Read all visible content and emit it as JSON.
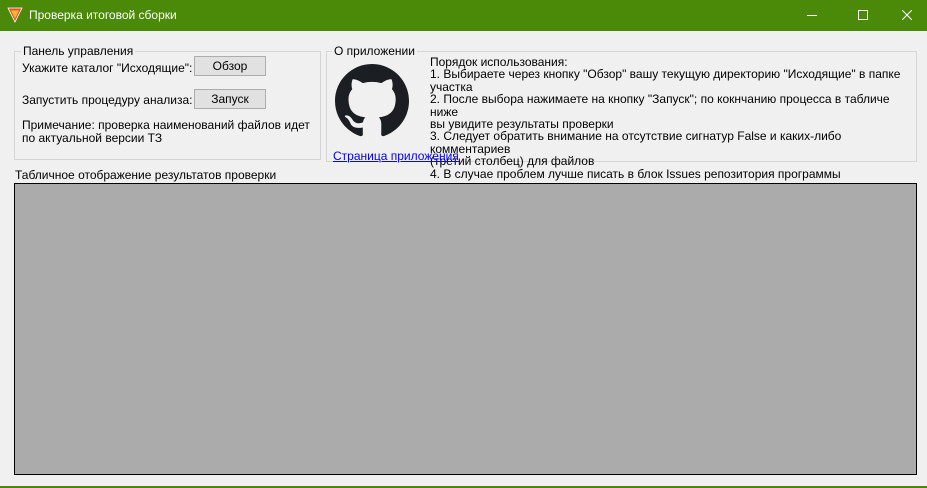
{
  "window": {
    "title": "Проверка итоговой сборки",
    "accent_color": "#4a8a08",
    "icon": "app-logo-icon"
  },
  "control_panel": {
    "legend": "Панель управления",
    "folder_label": "Укажите каталог \"Исходящие\":",
    "browse_button": "Обзор",
    "run_label": "Запустить процедуру анализа:",
    "run_button": "Запуск",
    "note_line1": "Примечание: проверка наименований файлов идет",
    "note_line2": "по актуальной версии ТЗ"
  },
  "about": {
    "legend": "О приложении",
    "logo_icon": "github-icon",
    "instructions": [
      "Порядок использования:",
      "1. Выбираете через кнопку \"Обзор\" вашу текущую директорию \"Исходящие\" в папке участка",
      "2. После выбора нажимаете на кнопку \"Запуск\"; по кокнчанию процесса в табличе ниже",
      "вы увидите результаты проверки",
      "3. Следует обратить внимание на отсутствие сигнатур False и каких-либо комментариев",
      "(третий столбец) для файлов",
      "4. В случае проблем лучше писать в блок Issues репозитория программы"
    ],
    "link_text": "Страница приложения"
  },
  "results": {
    "label": "Табличное отображение результатов проверки"
  }
}
